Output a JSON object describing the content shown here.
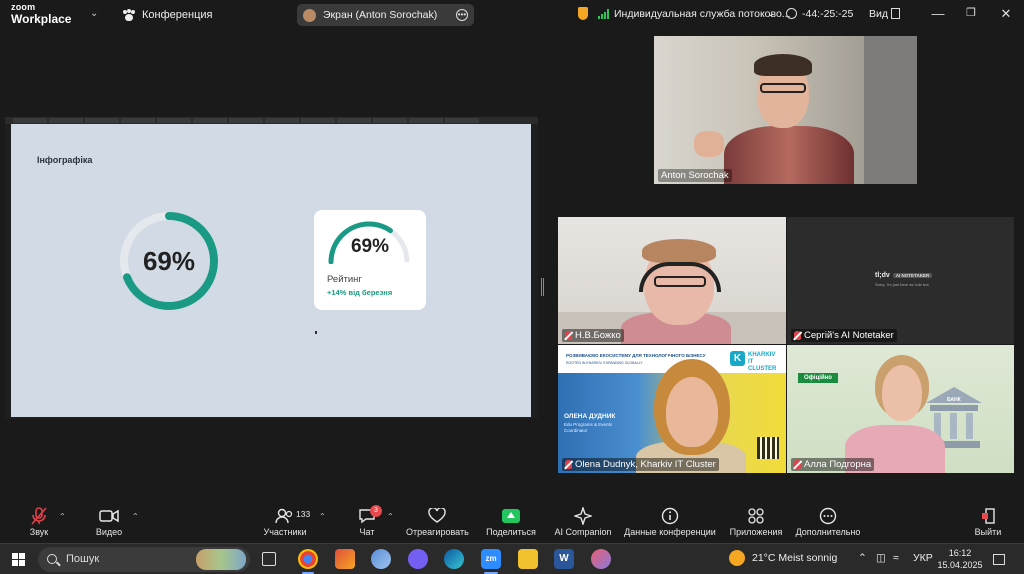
{
  "title_bar": {
    "logo_line1": "zoom",
    "logo_line2": "Workplace",
    "meeting_label": "Конференция",
    "screen_share_label": "Экран (Anton Sorochak)",
    "stream_label": "Индивидуальная служба потоково...",
    "timer": "-44:-25:-25",
    "view_label": "Вид"
  },
  "slide": {
    "title": "Інфографіка",
    "donut": {
      "percent": 69,
      "label": "69%",
      "color": "#1a9a85",
      "track": "#e5e8ec"
    },
    "card": {
      "percent": 69,
      "label_pct": "69%",
      "label": "Рейтинг",
      "sub": "+14% від березня",
      "color": "#1a9a85"
    }
  },
  "participants": {
    "anton": {
      "name": "Anton Sorochak"
    },
    "bozhko": {
      "name": "Н.В.Божко"
    },
    "notetaker": {
      "name": "Сергій's AI Notetaker",
      "logo": "tl;dv",
      "logo_badge": "AI NOTETAKER",
      "logo_sub": "Sorry, I'm just here as tl;dv bot"
    },
    "olena": {
      "name": "Olena Dudnyk, Kharkiv IT Cluster",
      "banner_line1": "РОЗВИВАЄМО ЕКОСИСТЕМУ ДЛЯ ТЕХНОЛОГІЧНОГО БІЗНЕСУ",
      "banner_line2": "ROOTED IN KHARKIV. EXPANDING GLOBALLY",
      "cluster_line1": "KHARKIV",
      "cluster_line2": "IT CLUSTER",
      "cluster_letter": "K",
      "speaker_name": "ОЛЕНА ДУДНИК",
      "speaker_role1": "Edu Programs & Events",
      "speaker_role2": "Coordinator"
    },
    "alla": {
      "name": "Алла Подгорна",
      "badge": "Офіційно",
      "bank_label": "БАНК"
    }
  },
  "controls": {
    "audio": "Звук",
    "video": "Видео",
    "participants": "Участники",
    "participants_count": "133",
    "chat": "Чат",
    "chat_badge": "3",
    "react": "Отреагировать",
    "share": "Поделиться",
    "ai": "AI Companion",
    "info": "Данные конференции",
    "apps": "Приложения",
    "more": "Дополнительно",
    "leave": "Выйти"
  },
  "taskbar": {
    "search_placeholder": "Пошук",
    "weather": "21°C  Meist sonnig",
    "lang": "УКР",
    "time": "16:12",
    "date": "15.04.2025"
  },
  "colors": {
    "accent_green": "#22c55e",
    "muted_red": "#e0414a",
    "teal": "#1a9a85"
  }
}
